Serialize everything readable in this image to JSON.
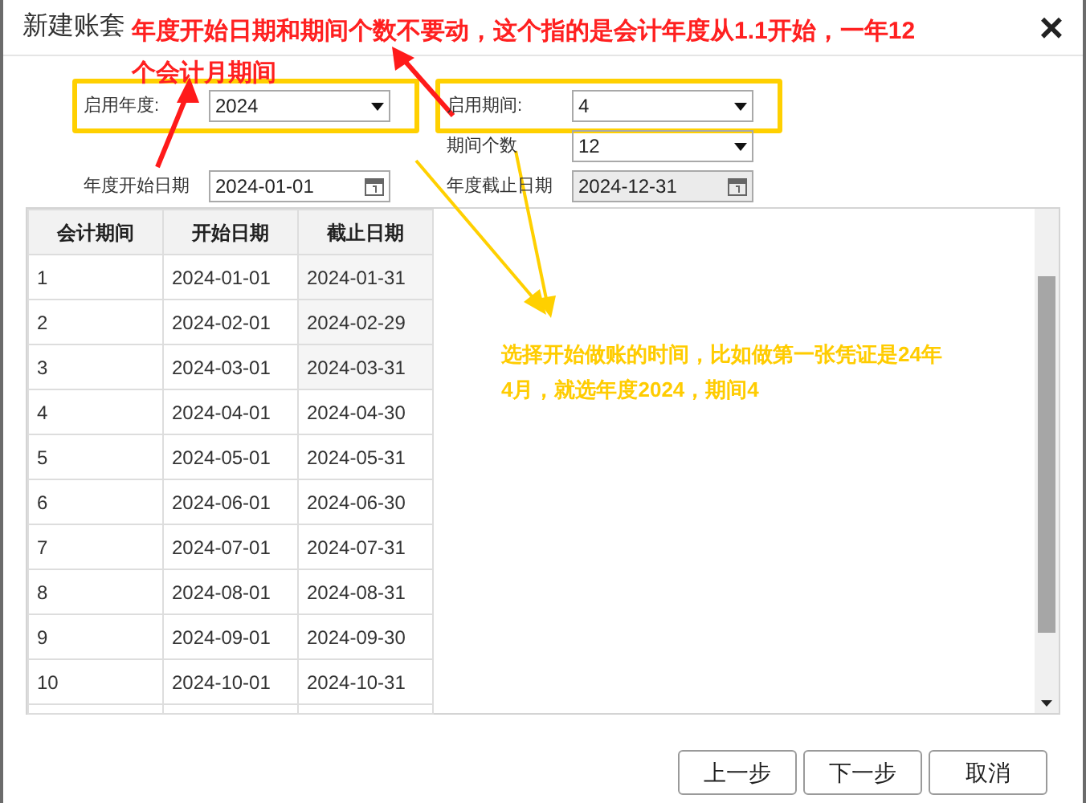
{
  "window": {
    "title": "新建账套",
    "close": "×"
  },
  "form": [
    {
      "kind": "select",
      "label": "启用年度:",
      "value": "2024",
      "highlighted": true
    },
    {
      "kind": "select",
      "label": "启用期间:",
      "value": "4",
      "highlighted": true
    },
    {
      "kind": "select",
      "label": "期间个数",
      "value": "12",
      "highlighted": false
    },
    {
      "kind": "date",
      "label": "年度开始日期",
      "value": "2024-01-01",
      "highlighted": false,
      "readonly": false
    },
    {
      "kind": "date",
      "label": "年度截止日期",
      "value": "2024-12-31",
      "highlighted": false,
      "readonly": true
    }
  ],
  "table": {
    "columns": [
      "会计期间",
      "开始日期",
      "截止日期"
    ],
    "rows": [
      [
        "1",
        "2024-01-01",
        "2024-01-31"
      ],
      [
        "2",
        "2024-02-01",
        "2024-02-29"
      ],
      [
        "3",
        "2024-03-01",
        "2024-03-31"
      ],
      [
        "4",
        "2024-04-01",
        "2024-04-30"
      ],
      [
        "5",
        "2024-05-01",
        "2024-05-31"
      ],
      [
        "6",
        "2024-06-01",
        "2024-06-30"
      ],
      [
        "7",
        "2024-07-01",
        "2024-07-31"
      ],
      [
        "8",
        "2024-08-01",
        "2024-08-31"
      ],
      [
        "9",
        "2024-09-01",
        "2024-09-30"
      ],
      [
        "10",
        "2024-10-01",
        "2024-10-31"
      ]
    ]
  },
  "buttons": [
    "上一步",
    "下一步",
    "取消"
  ],
  "annotations": [
    {
      "kind": "red",
      "lines": [
        "年度开始日期和期间个数不要动，这个指的是会计年度从1.1开始，一年12",
        "个会计月期间"
      ]
    },
    {
      "kind": "yellow",
      "lines": [
        "选择开始做账的时间，比如做第一张凭证是24年",
        "4月，就选年度2024，期间4"
      ]
    }
  ]
}
